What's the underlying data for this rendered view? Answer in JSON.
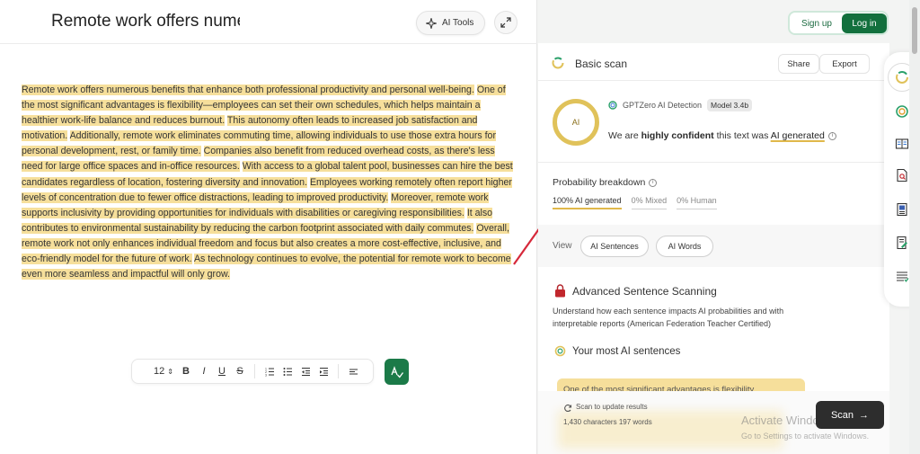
{
  "editor": {
    "title": "Remote work offers nume",
    "ai_tools_label": "AI Tools",
    "paragraph": [
      "Remote work offers numerous benefits that enhance both professional productivity and personal well-being.",
      "One of the most significant advantages is flexibility—employees can set their own schedules, which helps maintain a healthier work-life balance and reduces burnout.",
      "This autonomy often leads to increased job satisfaction and motivation.",
      "Additionally, remote work eliminates commuting time, allowing individuals to use those extra hours for personal development, rest, or family time.",
      "Companies also benefit from reduced overhead costs, as there's less need for large office spaces and in-office resources.",
      "With access to a global talent pool, businesses can hire the best candidates regardless of location, fostering diversity and innovation.",
      "Employees working remotely often report higher levels of concentration due to fewer office distractions, leading to improved productivity.",
      "Moreover, remote work supports inclusivity by providing opportunities for individuals with disabilities or caregiving responsibilities.",
      "It also contributes to environmental sustainability by reducing the carbon footprint associated with daily commutes.",
      "Overall, remote work not only enhances individual freedom and focus but also creates a more cost-effective, inclusive, and eco-friendly model for the future of work.",
      "As technology continues to evolve, the potential for remote work to become even more seamless and impactful will only grow."
    ],
    "highlight_color": "#f6df9b",
    "toolbar": {
      "font_size": "12",
      "bold": "B",
      "italic": "I",
      "underline": "U",
      "strike": "S"
    }
  },
  "auth": {
    "signup": "Sign up",
    "login": "Log in"
  },
  "panel": {
    "scan_title": "Basic scan",
    "share": "Share",
    "export": "Export",
    "ring_label": "AI",
    "detector_name": "GPTZero AI Detection",
    "model_badge": "Model 3.4b",
    "verdict_pre": "We are ",
    "verdict_conf": "highly confident",
    "verdict_mid": " this text was ",
    "verdict_result": "AI generated",
    "prob_title": "Probability breakdown",
    "prob_tabs": [
      "100% AI generated",
      "0% Mixed",
      "0% Human"
    ],
    "ai_probability": 1.0,
    "view_label": "View",
    "view_buttons": [
      "AI Sentences",
      "AI Words"
    ],
    "adv_title": "Advanced Sentence Scanning",
    "adv_desc": "Understand how each sentence impacts AI probabilities and with interpretable reports (American Federation Teacher Certified)",
    "most_title": "Your most AI sentences",
    "top_sentence": "One of the most significant advantages is flexibility",
    "scan_note": "Scan to update results",
    "counts": "1,430 characters 197 words",
    "scan_button": "Scan",
    "accent_color": "#12703d",
    "ai_color": "#e0c25a"
  },
  "watermark": {
    "line1": "Activate Windows",
    "line2": "Go to Settings to activate Windows."
  },
  "rail": {
    "icons": [
      "gptzero-logo-icon",
      "ai-detector-icon",
      "compare-icon",
      "plagiarism-icon",
      "document-icon",
      "edit-icon",
      "report-icon"
    ]
  }
}
